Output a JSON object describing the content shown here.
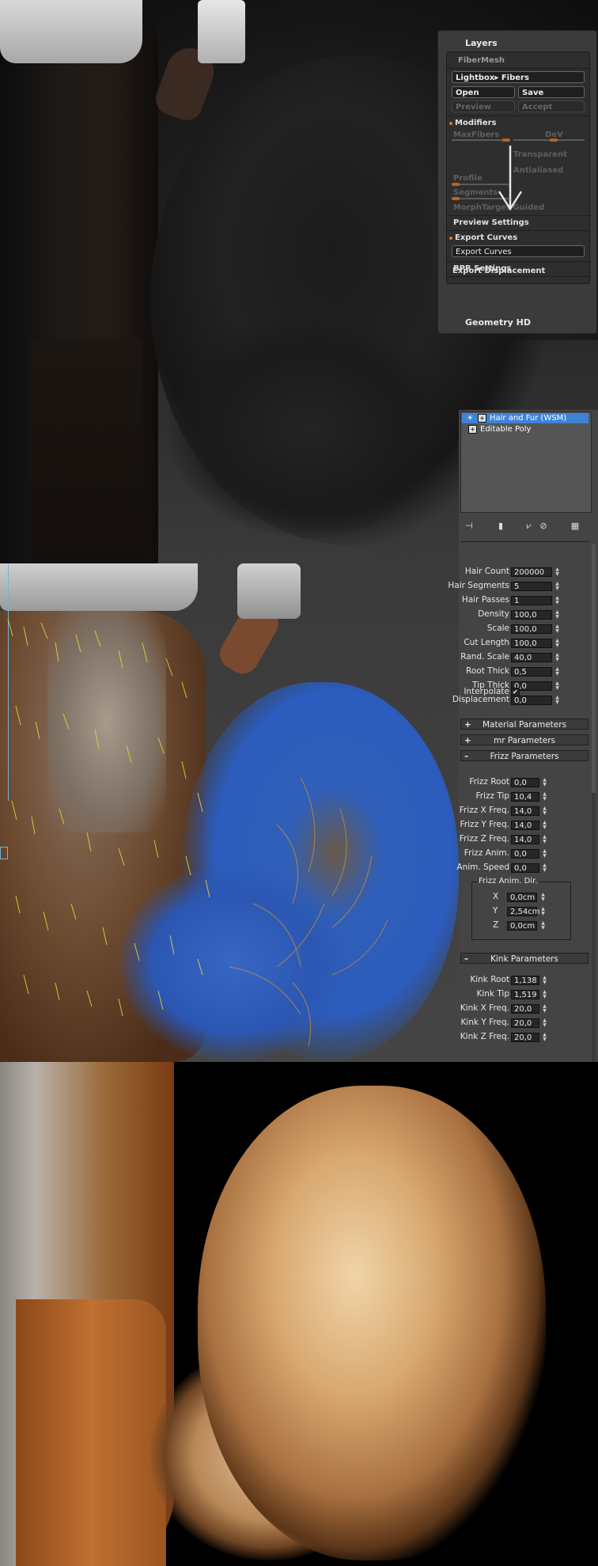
{
  "zbrush": {
    "layers_label": "Layers",
    "fibermesh_label": "FiberMesh",
    "lightbox_btn": "Lightbox▸ Fibers",
    "open_btn": "Open",
    "save_btn": "Save",
    "preview_btn": "Preview",
    "accept_btn": "Accept",
    "modifiers_label": "Modifiers",
    "maxfibers_label": "MaxFibers",
    "dev_label": "DeV",
    "transparent_label": "Transparent",
    "antialiased_label": "Antialiased",
    "profile_label": "Profile",
    "segments_label": "Segments",
    "morphtarget_label": "MorphTarget Guided",
    "preview_settings_label": "Preview Settings",
    "export_curves_header": "Export Curves",
    "export_curves_btn": "Export Curves",
    "bpr_settings_label": "BPR Settings",
    "export_displacement_label": "Export Displacement",
    "geometry_hd_label": "Geometry HD"
  },
  "max": {
    "modifier_stack": [
      {
        "label": "Hair and Fur (WSM)",
        "selected": true
      },
      {
        "label": "Editable Poly",
        "selected": false
      }
    ],
    "general": [
      {
        "label": "Hair Count",
        "value": "200000"
      },
      {
        "label": "Hair Segments",
        "value": "5"
      },
      {
        "label": "Hair Passes",
        "value": "1"
      },
      {
        "label": "Density",
        "value": "100,0"
      },
      {
        "label": "Scale",
        "value": "100,0"
      },
      {
        "label": "Cut Length",
        "value": "100,0"
      },
      {
        "label": "Rand. Scale",
        "value": "40,0"
      },
      {
        "label": "Root Thick",
        "value": "0,5"
      },
      {
        "label": "Tip Thick",
        "value": "0,0"
      },
      {
        "label": "Displacement",
        "value": "0,0"
      }
    ],
    "interpolate_label": "Interpolate",
    "interpolate_checked": "✔",
    "rollouts": {
      "material": {
        "sign": "+",
        "label": "Material Parameters"
      },
      "mr": {
        "sign": "+",
        "label": "mr Parameters"
      },
      "frizz": {
        "sign": "–",
        "label": "Frizz Parameters"
      },
      "kink": {
        "sign": "–",
        "label": "Kink Parameters"
      }
    },
    "frizz": [
      {
        "label": "Frizz Root",
        "value": "0,0"
      },
      {
        "label": "Frizz Tip",
        "value": "10,4"
      },
      {
        "label": "Frizz X Freq.",
        "value": "14,0"
      },
      {
        "label": "Frizz Y Freq.",
        "value": "14,0"
      },
      {
        "label": "Frizz Z Freq.",
        "value": "14,0"
      },
      {
        "label": "Frizz Anim.",
        "value": "0,0"
      },
      {
        "label": "Anim. Speed",
        "value": "0,0"
      }
    ],
    "frizz_anim_dir": {
      "label": "Frizz Anim. Dir.",
      "axes": [
        {
          "label": "X",
          "value": "0,0cm"
        },
        {
          "label": "Y",
          "value": "2,54cm"
        },
        {
          "label": "Z",
          "value": "0,0cm"
        }
      ]
    },
    "kink": [
      {
        "label": "Kink Root",
        "value": "1,138"
      },
      {
        "label": "Kink Tip",
        "value": "1,519"
      },
      {
        "label": "Kink X Freq.",
        "value": "20,0"
      },
      {
        "label": "Kink Y Freq.",
        "value": "20,0"
      },
      {
        "label": "Kink Z Freq.",
        "value": "20,0"
      }
    ]
  },
  "colors": {
    "zbrush_accent": "#e07a20",
    "max_selection": "#3d83d8",
    "guide_hair": "#e6da3a",
    "viewport_hair": "#2c5cbd"
  }
}
